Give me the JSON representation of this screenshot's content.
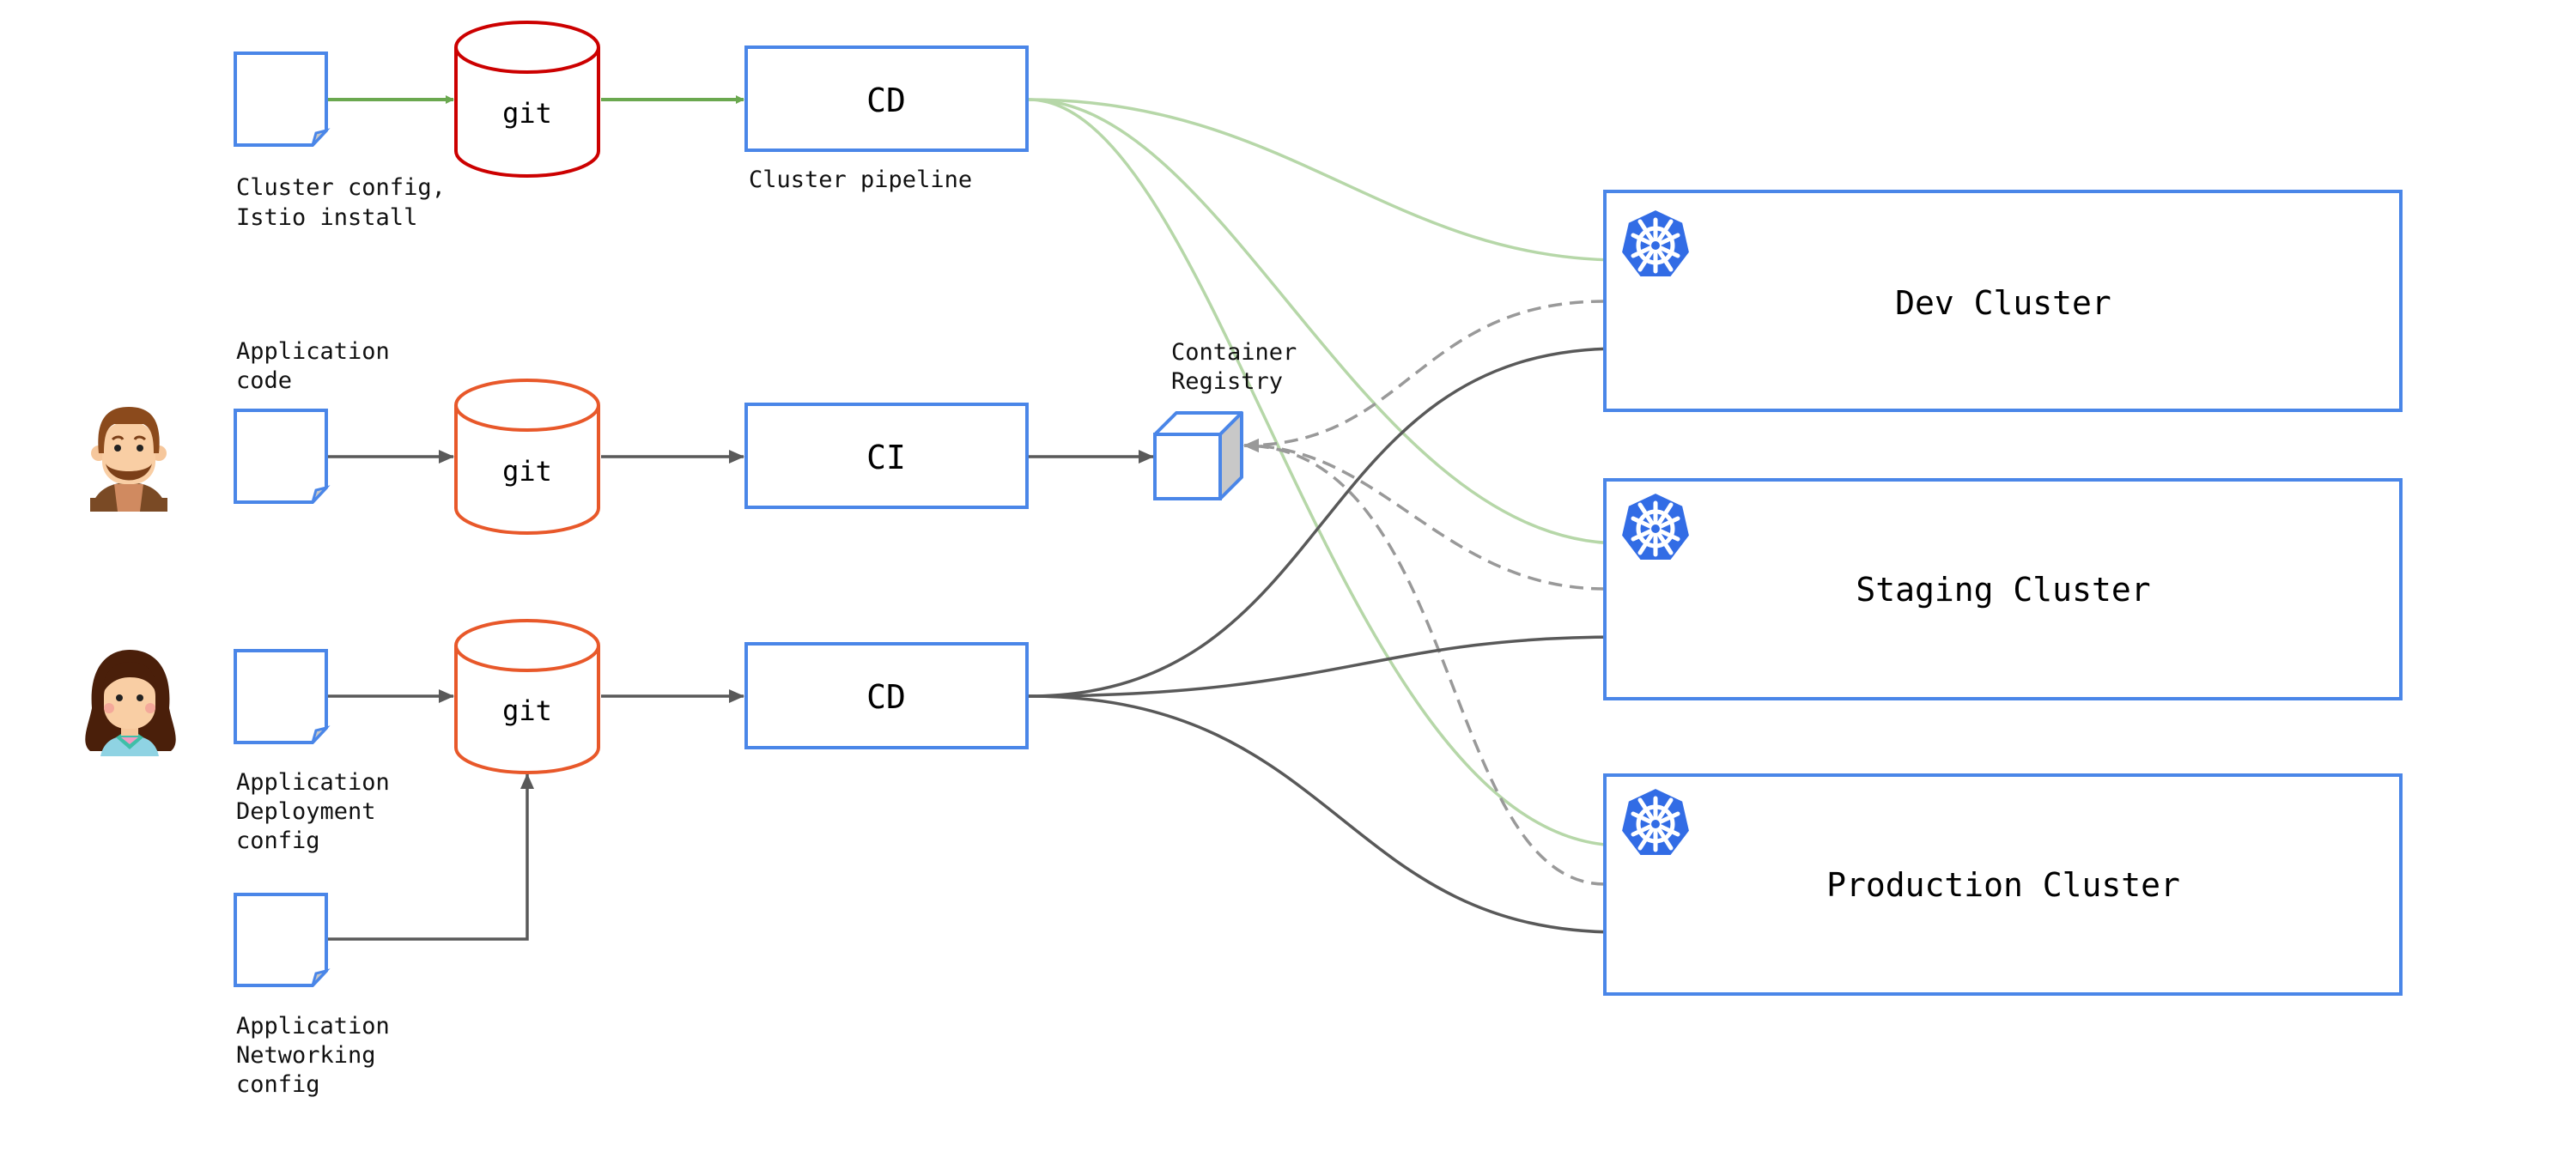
{
  "colors": {
    "box_border": "#4a86e8",
    "git_cluster_repo": "#cc0000",
    "git_app_repo": "#e8582a",
    "cluster_pipeline_edge": "#6aa84f",
    "cluster_deploy_edge": "#b6d7a8",
    "app_edge": "#595959",
    "image_pull_edge": "#999999",
    "kubernetes_blue": "#326ce5"
  },
  "rows": {
    "cluster": {
      "doc_label_lines": [
        "Cluster config,",
        "Istio install"
      ],
      "repo_label": "git",
      "pipeline_label": "CD",
      "pipeline_caption": "Cluster pipeline"
    },
    "app_code": {
      "doc_label_lines": [
        "Application",
        "code"
      ],
      "repo_label": "git",
      "pipeline_label": "CI",
      "persona": "developer-avatar"
    },
    "app_deploy": {
      "doc_label_lines": [
        "Application",
        "Deployment",
        "config"
      ],
      "repo_label": "git",
      "pipeline_label": "CD",
      "persona": "operator-avatar"
    },
    "app_network": {
      "doc_label_lines": [
        "Application",
        "Networking",
        "config"
      ]
    }
  },
  "registry": {
    "label_lines": [
      "Container",
      "Registry"
    ],
    "icon": "cube-icon"
  },
  "clusters": [
    {
      "name": "Dev Cluster",
      "icon": "kubernetes-icon"
    },
    {
      "name": "Staging Cluster",
      "icon": "kubernetes-icon"
    },
    {
      "name": "Production Cluster",
      "icon": "kubernetes-icon"
    }
  ]
}
